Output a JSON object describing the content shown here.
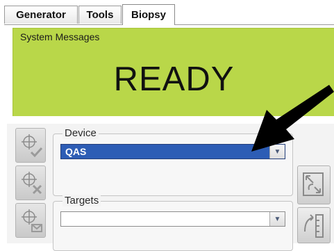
{
  "tabs": {
    "generator": "Generator",
    "tools": "Tools",
    "biopsy": "Biopsy",
    "active": "Biopsy"
  },
  "system_messages": {
    "label": "System Messages",
    "status": "READY",
    "background_color": "#b9d749"
  },
  "device": {
    "label": "Device",
    "selected_value": "QAS",
    "highlight_color": "#2d5db5"
  },
  "targets": {
    "label": "Targets",
    "selected_value": ""
  },
  "side_buttons": {
    "icons": [
      "target-check-icon",
      "target-cancel-icon",
      "target-send-icon"
    ]
  },
  "right_buttons": {
    "icons": [
      "corner-arrows-icon",
      "ruler-measure-icon"
    ]
  },
  "annotation": {
    "icon": "black-arrow-icon",
    "color": "#000000"
  }
}
